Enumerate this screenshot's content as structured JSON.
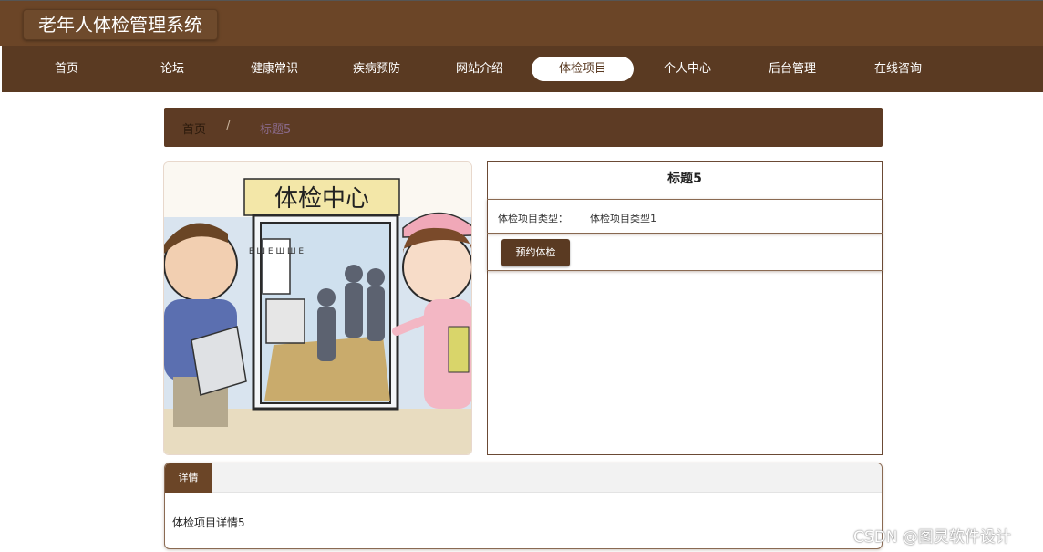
{
  "header": {
    "title": "老年人体检管理系统"
  },
  "nav": {
    "items": [
      {
        "label": "首页"
      },
      {
        "label": "论坛"
      },
      {
        "label": "健康常识"
      },
      {
        "label": "疾病预防"
      },
      {
        "label": "网站介绍"
      },
      {
        "label": "体检项目"
      },
      {
        "label": "个人中心"
      },
      {
        "label": "后台管理"
      },
      {
        "label": "在线咨询"
      }
    ],
    "active": "体检项目"
  },
  "breadcrumb": {
    "home": "首页",
    "separator": "/",
    "current": "标题5"
  },
  "image": {
    "sign_text": "体检中心",
    "chart_text": "E Ш E Ш Ш E"
  },
  "info": {
    "title": "标题5",
    "type_label": "体检项目类型：",
    "type_value": "体检项目类型1",
    "book_button": "预约体检"
  },
  "detail": {
    "tab_label": "详情",
    "content": "体检项目详情5"
  },
  "watermark": "CSDN @图灵软件设计",
  "colors": {
    "brand_brown": "#6b4527",
    "nav_brown": "#5a3a22",
    "active_bg": "#ffffff"
  }
}
